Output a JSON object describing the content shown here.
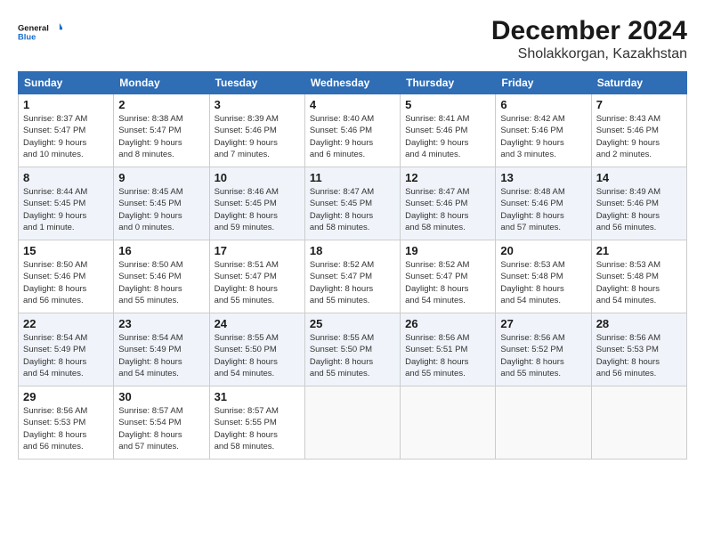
{
  "header": {
    "logo_line1": "General",
    "logo_line2": "Blue",
    "month": "December 2024",
    "location": "Sholakkorgan, Kazakhstan"
  },
  "weekdays": [
    "Sunday",
    "Monday",
    "Tuesday",
    "Wednesday",
    "Thursday",
    "Friday",
    "Saturday"
  ],
  "weeks": [
    [
      {
        "day": "1",
        "info": "Sunrise: 8:37 AM\nSunset: 5:47 PM\nDaylight: 9 hours\nand 10 minutes."
      },
      {
        "day": "2",
        "info": "Sunrise: 8:38 AM\nSunset: 5:47 PM\nDaylight: 9 hours\nand 8 minutes."
      },
      {
        "day": "3",
        "info": "Sunrise: 8:39 AM\nSunset: 5:46 PM\nDaylight: 9 hours\nand 7 minutes."
      },
      {
        "day": "4",
        "info": "Sunrise: 8:40 AM\nSunset: 5:46 PM\nDaylight: 9 hours\nand 6 minutes."
      },
      {
        "day": "5",
        "info": "Sunrise: 8:41 AM\nSunset: 5:46 PM\nDaylight: 9 hours\nand 4 minutes."
      },
      {
        "day": "6",
        "info": "Sunrise: 8:42 AM\nSunset: 5:46 PM\nDaylight: 9 hours\nand 3 minutes."
      },
      {
        "day": "7",
        "info": "Sunrise: 8:43 AM\nSunset: 5:46 PM\nDaylight: 9 hours\nand 2 minutes."
      }
    ],
    [
      {
        "day": "8",
        "info": "Sunrise: 8:44 AM\nSunset: 5:45 PM\nDaylight: 9 hours\nand 1 minute."
      },
      {
        "day": "9",
        "info": "Sunrise: 8:45 AM\nSunset: 5:45 PM\nDaylight: 9 hours\nand 0 minutes."
      },
      {
        "day": "10",
        "info": "Sunrise: 8:46 AM\nSunset: 5:45 PM\nDaylight: 8 hours\nand 59 minutes."
      },
      {
        "day": "11",
        "info": "Sunrise: 8:47 AM\nSunset: 5:45 PM\nDaylight: 8 hours\nand 58 minutes."
      },
      {
        "day": "12",
        "info": "Sunrise: 8:47 AM\nSunset: 5:46 PM\nDaylight: 8 hours\nand 58 minutes."
      },
      {
        "day": "13",
        "info": "Sunrise: 8:48 AM\nSunset: 5:46 PM\nDaylight: 8 hours\nand 57 minutes."
      },
      {
        "day": "14",
        "info": "Sunrise: 8:49 AM\nSunset: 5:46 PM\nDaylight: 8 hours\nand 56 minutes."
      }
    ],
    [
      {
        "day": "15",
        "info": "Sunrise: 8:50 AM\nSunset: 5:46 PM\nDaylight: 8 hours\nand 56 minutes."
      },
      {
        "day": "16",
        "info": "Sunrise: 8:50 AM\nSunset: 5:46 PM\nDaylight: 8 hours\nand 55 minutes."
      },
      {
        "day": "17",
        "info": "Sunrise: 8:51 AM\nSunset: 5:47 PM\nDaylight: 8 hours\nand 55 minutes."
      },
      {
        "day": "18",
        "info": "Sunrise: 8:52 AM\nSunset: 5:47 PM\nDaylight: 8 hours\nand 55 minutes."
      },
      {
        "day": "19",
        "info": "Sunrise: 8:52 AM\nSunset: 5:47 PM\nDaylight: 8 hours\nand 54 minutes."
      },
      {
        "day": "20",
        "info": "Sunrise: 8:53 AM\nSunset: 5:48 PM\nDaylight: 8 hours\nand 54 minutes."
      },
      {
        "day": "21",
        "info": "Sunrise: 8:53 AM\nSunset: 5:48 PM\nDaylight: 8 hours\nand 54 minutes."
      }
    ],
    [
      {
        "day": "22",
        "info": "Sunrise: 8:54 AM\nSunset: 5:49 PM\nDaylight: 8 hours\nand 54 minutes."
      },
      {
        "day": "23",
        "info": "Sunrise: 8:54 AM\nSunset: 5:49 PM\nDaylight: 8 hours\nand 54 minutes."
      },
      {
        "day": "24",
        "info": "Sunrise: 8:55 AM\nSunset: 5:50 PM\nDaylight: 8 hours\nand 54 minutes."
      },
      {
        "day": "25",
        "info": "Sunrise: 8:55 AM\nSunset: 5:50 PM\nDaylight: 8 hours\nand 55 minutes."
      },
      {
        "day": "26",
        "info": "Sunrise: 8:56 AM\nSunset: 5:51 PM\nDaylight: 8 hours\nand 55 minutes."
      },
      {
        "day": "27",
        "info": "Sunrise: 8:56 AM\nSunset: 5:52 PM\nDaylight: 8 hours\nand 55 minutes."
      },
      {
        "day": "28",
        "info": "Sunrise: 8:56 AM\nSunset: 5:53 PM\nDaylight: 8 hours\nand 56 minutes."
      }
    ],
    [
      {
        "day": "29",
        "info": "Sunrise: 8:56 AM\nSunset: 5:53 PM\nDaylight: 8 hours\nand 56 minutes."
      },
      {
        "day": "30",
        "info": "Sunrise: 8:57 AM\nSunset: 5:54 PM\nDaylight: 8 hours\nand 57 minutes."
      },
      {
        "day": "31",
        "info": "Sunrise: 8:57 AM\nSunset: 5:55 PM\nDaylight: 8 hours\nand 58 minutes."
      },
      {
        "day": "",
        "info": ""
      },
      {
        "day": "",
        "info": ""
      },
      {
        "day": "",
        "info": ""
      },
      {
        "day": "",
        "info": ""
      }
    ]
  ]
}
